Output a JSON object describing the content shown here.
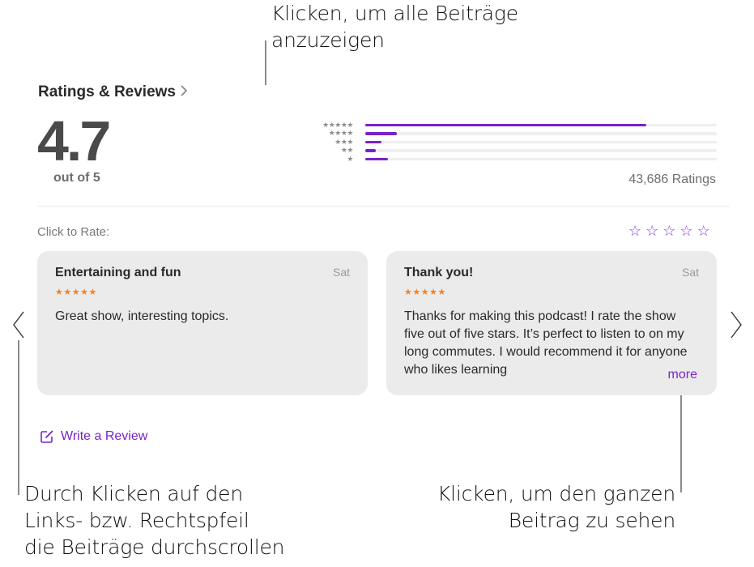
{
  "callouts": {
    "top": [
      "Klicken, um alle Beiträge",
      "anzuzeigen"
    ],
    "bottom_left": [
      "Durch Klicken auf den",
      "Links- bzw. Rechtspfeil",
      "die Beiträge durchscrollen"
    ],
    "bottom_right": [
      "Klicken, um den ganzen",
      "Beitrag zu sehen"
    ]
  },
  "ratings": {
    "title": "Ratings & Reviews",
    "chevron_icon": "chevron-right-icon",
    "average": "4.7",
    "out_of": "out of 5",
    "count_label": "43,686 Ratings",
    "accent_color": "#7a22c9",
    "histogram": [
      {
        "stars": 5,
        "label": "★★★★★",
        "fraction": 0.8
      },
      {
        "stars": 4,
        "label": "★★★★",
        "fraction": 0.09
      },
      {
        "stars": 3,
        "label": "★★★",
        "fraction": 0.045
      },
      {
        "stars": 2,
        "label": "★★",
        "fraction": 0.03
      },
      {
        "stars": 1,
        "label": "★",
        "fraction": 0.065
      }
    ]
  },
  "rate": {
    "label": "Click to Rate:",
    "stars": [
      "☆",
      "☆",
      "☆",
      "☆",
      "☆"
    ],
    "star_icon": "star-outline-icon"
  },
  "reviews": [
    {
      "title": "Entertaining and fun",
      "date": "Sat",
      "stars": "★★★★★",
      "rating": 5,
      "body": "Great show, interesting topics."
    },
    {
      "title": "Thank you!",
      "date": "Sat",
      "stars": "★★★★★",
      "rating": 5,
      "body": "Thanks for making this podcast! I rate the show five out of five stars. It’s perfect to listen to on my long commutes. I would recommend it for anyone who likes learning",
      "more_label": "more"
    }
  ],
  "navigation": {
    "prev_icon": "chevron-left-icon",
    "next_icon": "chevron-right-icon"
  },
  "write_review": {
    "label": "Write a Review",
    "icon": "compose-icon"
  }
}
